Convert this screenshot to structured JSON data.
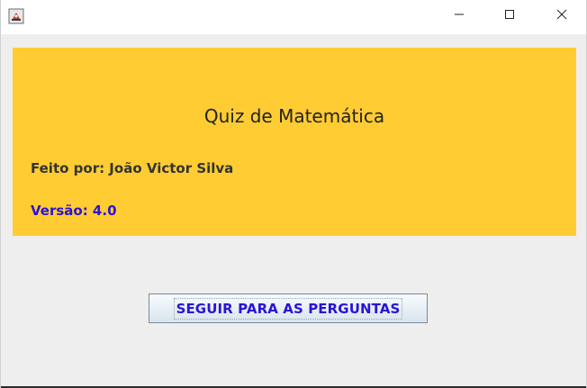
{
  "window": {
    "icon": "java-app-icon",
    "controls": {
      "minimize_icon": "minimize-icon",
      "maximize_icon": "maximize-icon",
      "close_icon": "close-icon"
    }
  },
  "header": {
    "title": "Quiz de Matemática",
    "author": "Feito por: João Victor Silva",
    "version": "Versão: 4.0",
    "background_color": "#ffcc33",
    "version_color": "#2a14d6"
  },
  "actions": {
    "next_label": "SEGUIR PARA AS PERGUNTAS"
  }
}
